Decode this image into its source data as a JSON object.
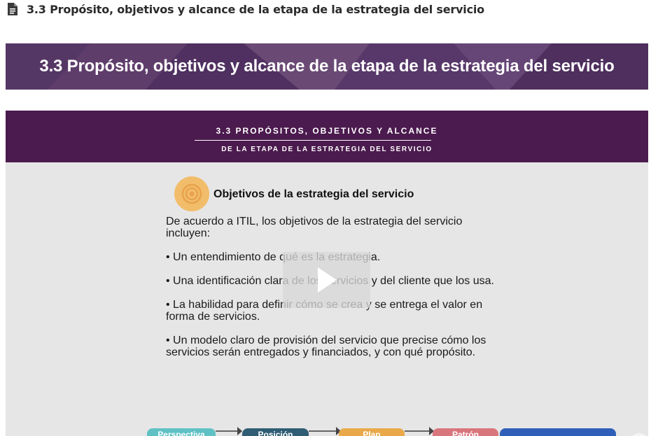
{
  "page": {
    "title": "3.3 Propósito, objetivos y alcance de la etapa de la estrategia del servicio",
    "icon": "document-icon"
  },
  "banner": {
    "title": "3.3 Propósito, objetivos y alcance de la etapa de la estrategia del servicio",
    "bg_color": "#4a2d57"
  },
  "video": {
    "slide_header": {
      "line1": "3.3 PROPÓSITOS, OBJETIVOS Y ALCANCE",
      "line2": "DE LA ETAPA DE LA ESTRATEGIA DEL SERVICIO",
      "bg_color": "#4b1a4e"
    },
    "subtitle": "Objetivos de la estrategia del servicio",
    "subtitle_icon": "target-icon",
    "paragraphs": [
      "De acuerdo a ITIL, los objetivos de la estrategia del servicio incluyen:",
      "• Un entendimiento de qué es la estrategia.",
      "• Una identificación clara de los servicios y del cliente que los usa.",
      "• La habilidad para definir cómo se crea y se entrega el valor en forma de servicios.",
      "• Un modelo claro de provisión del servicio que precise cómo los servicios serán entregados y financiados, y con qué propósito."
    ],
    "play_icon": "play-icon",
    "flow": [
      {
        "label": "Perspectiva",
        "color": "#5fc1c4"
      },
      {
        "label": "Posición",
        "color": "#2f5d74"
      },
      {
        "label": "Plan",
        "color": "#e9a94a"
      },
      {
        "label": "Patrón",
        "color": "#d9767d"
      },
      {
        "label": "",
        "color": "#2f5fb8"
      }
    ]
  }
}
